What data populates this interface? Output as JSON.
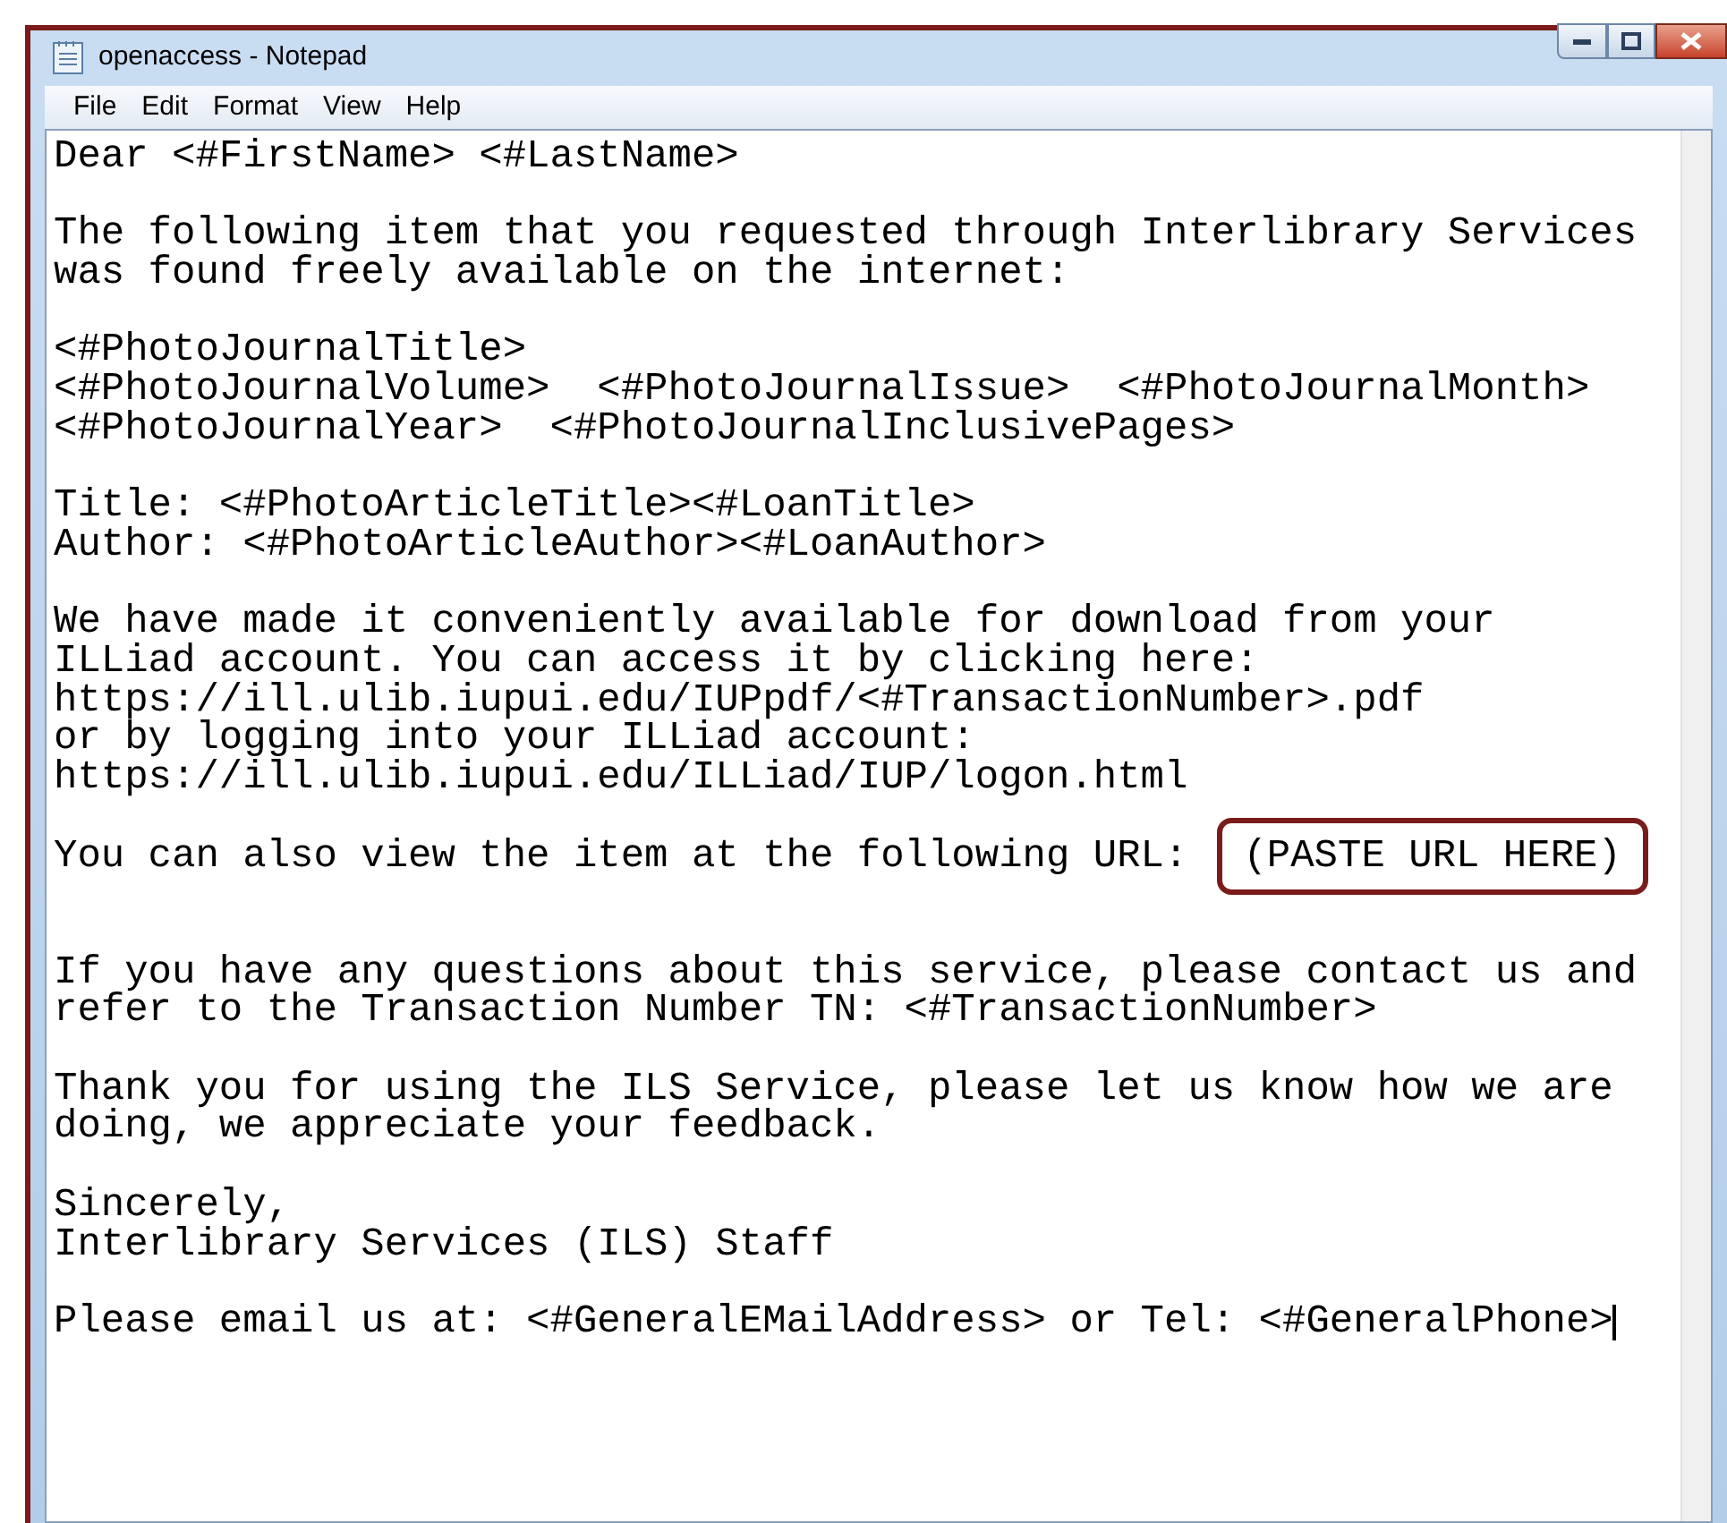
{
  "window": {
    "title": "openaccess - Notepad"
  },
  "menu": [
    "File",
    "Edit",
    "Format",
    "View",
    "Help"
  ],
  "paragraphs": [
    {
      "lines": [
        "Dear <#FirstName> <#LastName>"
      ]
    },
    {
      "lines": [
        "The following item that you requested through Interlibrary Services",
        "was found freely available on the internet:"
      ]
    },
    {
      "lines": [
        "<#PhotoJournalTitle>",
        "<#PhotoJournalVolume>  <#PhotoJournalIssue>  <#PhotoJournalMonth>",
        "<#PhotoJournalYear>  <#PhotoJournalInclusivePages>"
      ]
    },
    {
      "lines": [
        "Title: <#PhotoArticleTitle><#LoanTitle>",
        "Author: <#PhotoArticleAuthor><#LoanAuthor>"
      ]
    },
    {
      "lines": [
        "We have made it conveniently available for download from your",
        "ILLiad account. You can access it by clicking here:",
        "https://ill.ulib.iupui.edu/IUPpdf/<#TransactionNumber>.pdf",
        "or by logging into your ILLiad account:",
        "https://ill.ulib.iupui.edu/ILLiad/IUP/logon.html"
      ]
    },
    {
      "lines": [
        "You can also view the item at the following URL:"
      ],
      "highlight": "(PASTE URL HERE)"
    },
    {
      "lines": [
        "If you have any questions about this service, please contact us and",
        "refer to the Transaction Number TN: <#TransactionNumber>"
      ]
    },
    {
      "lines": [
        "Thank you for using the ILS Service, please let us know how we are",
        "doing, we appreciate your feedback."
      ]
    },
    {
      "lines": [
        "Sincerely,",
        "Interlibrary Services (ILS) Staff"
      ]
    },
    {
      "lines": [
        "Please email us at: <#GeneralEMailAddress> or Tel: <#GeneralPhone>"
      ],
      "caret": true
    }
  ]
}
